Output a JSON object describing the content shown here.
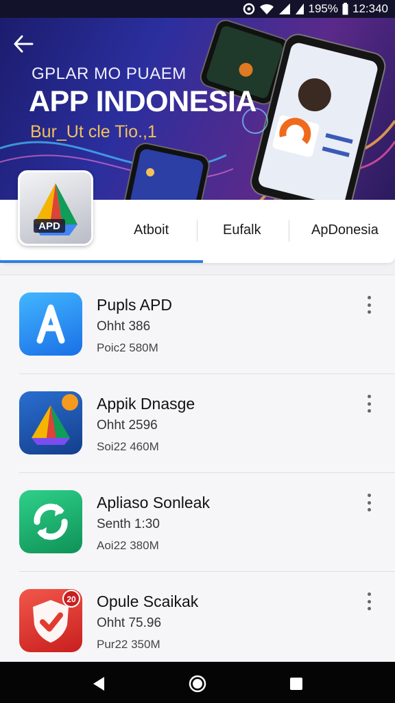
{
  "status_bar": {
    "battery": "195%",
    "time": "12:340"
  },
  "hero": {
    "kicker": "GPLAR MO PUAEM",
    "title": "APP INDONESIA",
    "subtitle": "Bur_Ut cle Tio.,1",
    "logo_text": "APD"
  },
  "tabs": [
    {
      "label": "Atboit"
    },
    {
      "label": "Eufalk"
    },
    {
      "label": "ApDonesia"
    }
  ],
  "apps": [
    {
      "title": "Pupls APD",
      "meta1": "Ohht 386",
      "meta2": "Poic2 580M",
      "icon": "a-letter-icon",
      "color": "#2a8cf2"
    },
    {
      "title": "Appik Dnasge",
      "meta1": "Ohht 2596",
      "meta2": "Soi22 460M",
      "icon": "triangle-logo-icon",
      "color": "#1e5fb0"
    },
    {
      "title": "Apliaso Sonleak",
      "meta1": "Senth 1:30",
      "meta2": "Aoi22 380M",
      "icon": "refresh-icon",
      "color": "#1aa86a"
    },
    {
      "title": "Opule Scaikak",
      "meta1": "Ohht 75.96",
      "meta2": "Pur22 350M",
      "icon": "shield-check-icon",
      "color": "#e23a2e"
    }
  ],
  "app4_badge": "20"
}
